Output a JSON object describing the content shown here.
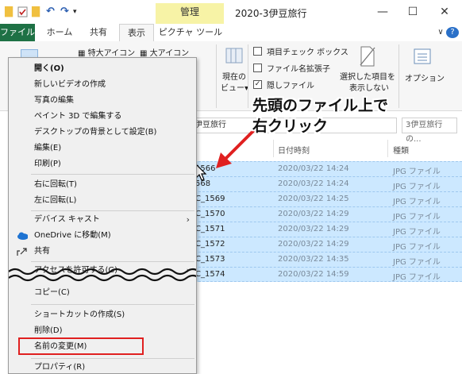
{
  "titlebar": {
    "manage_tab": "管理",
    "window_title": "2020-3伊豆旅行",
    "minimize": "—",
    "maximize": "☐",
    "close": "✕"
  },
  "tabs": [
    {
      "label": "ファイル"
    },
    {
      "label": "ホーム"
    },
    {
      "label": "共有"
    },
    {
      "label": "表示"
    },
    {
      "label": "ピクチャ ツール"
    }
  ],
  "ribbon": {
    "extra_large_icons": "特大アイコン",
    "large_icons": "大アイコン",
    "current_view": "現在の",
    "current_view2": "ビュー▾",
    "item_checkboxes": "項目チェック ボックス",
    "file_extensions": "ファイル名拡張子",
    "hidden_files": "隠しファイル",
    "hide_selected": "選択した項目を",
    "hide_selected2": "表示しない",
    "options": "オプション",
    "expand": "∨",
    "help": "?"
  },
  "address": {
    "path": "伊豆旅行",
    "search_placeholder": "3伊豆旅行の..."
  },
  "columns": {
    "date": "日付時刻",
    "type": "種類"
  },
  "files": [
    {
      "name": "1566",
      "date": "2020/03/22 14:24",
      "type": "JPG ファイル"
    },
    {
      "name": "568",
      "date": "2020/03/22 14:24",
      "type": "JPG ファイル"
    },
    {
      "name": "C_1569",
      "date": "2020/03/22 14:25",
      "type": "JPG ファイル"
    },
    {
      "name": "C_1570",
      "date": "2020/03/22 14:29",
      "type": "JPG ファイル"
    },
    {
      "name": "C_1571",
      "date": "2020/03/22 14:29",
      "type": "JPG ファイル"
    },
    {
      "name": "C_1572",
      "date": "2020/03/22 14:29",
      "type": "JPG ファイル"
    },
    {
      "name": "C_1573",
      "date": "2020/03/22 14:35",
      "type": "JPG ファイル"
    },
    {
      "name": "C_1574",
      "date": "2020/03/22 14:59",
      "type": "JPG ファイル"
    }
  ],
  "context_menu": {
    "open": "開く(O)",
    "new_video": "新しいビデオの作成",
    "edit_photo": "写真の編集",
    "paint3d": "ペイント 3D で編集する",
    "set_desktop": "デスクトップの背景として設定(B)",
    "edit": "編集(E)",
    "print": "印刷(P)",
    "rotate_right": "右に回転(T)",
    "rotate_left": "左に回転(L)",
    "cast": "デバイス キャスト",
    "onedrive": "OneDrive に移動(M)",
    "share": "共有",
    "grant_access": "アクセスを許可する(G)",
    "copy": "コピー(C)",
    "shortcut": "ショートカットの作成(S)",
    "delete": "削除(D)",
    "rename": "名前の変更(M)",
    "properties": "プロパティ(R)"
  },
  "annotation": {
    "line1": "先頭のファイル上で",
    "line2": "右クリック"
  },
  "colors": {
    "file_tab": "#1e7145",
    "manage_tab": "#f7f3a6",
    "selection": "#cce8ff",
    "highlight": "#e02020",
    "arrow": "#e02020"
  }
}
